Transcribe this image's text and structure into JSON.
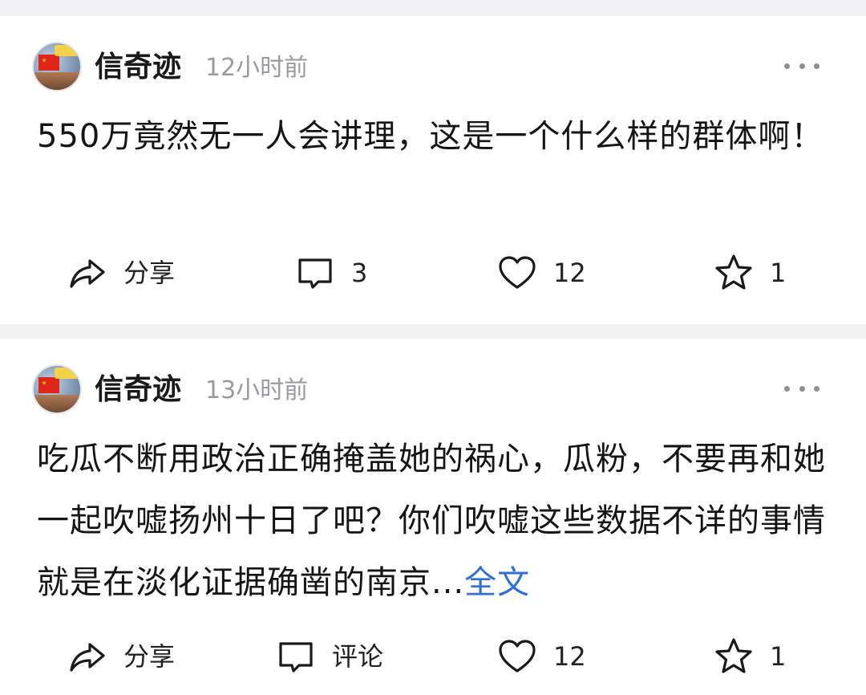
{
  "posts": [
    {
      "author": "信奇迹",
      "time": "12小时前",
      "content": "550万竟然无一人会讲理，这是一个什么样的群体啊！",
      "more_link": "",
      "actions": {
        "share": "分享",
        "comment": "3",
        "like": "12",
        "favorite": "1"
      }
    },
    {
      "author": "信奇迹",
      "time": "13小时前",
      "content": "吃瓜不断用政治正确掩盖她的祸心，瓜粉，不要再和她一起吹嘘扬州十日了吧？你们吹嘘这些数据不详的事情就是在淡化证据确凿的南京...",
      "more_link": "全文",
      "actions": {
        "share": "分享",
        "comment": "评论",
        "like": "12",
        "favorite": "1"
      }
    }
  ],
  "icons": {
    "share": "share-arrow-icon",
    "comment": "comment-bubble-icon",
    "like": "heart-icon",
    "favorite": "star-icon",
    "more": "more-dots-icon"
  },
  "colors": {
    "link": "#2f6fd6",
    "muted": "#9a9aa0",
    "separator": "#f2f2f4"
  }
}
